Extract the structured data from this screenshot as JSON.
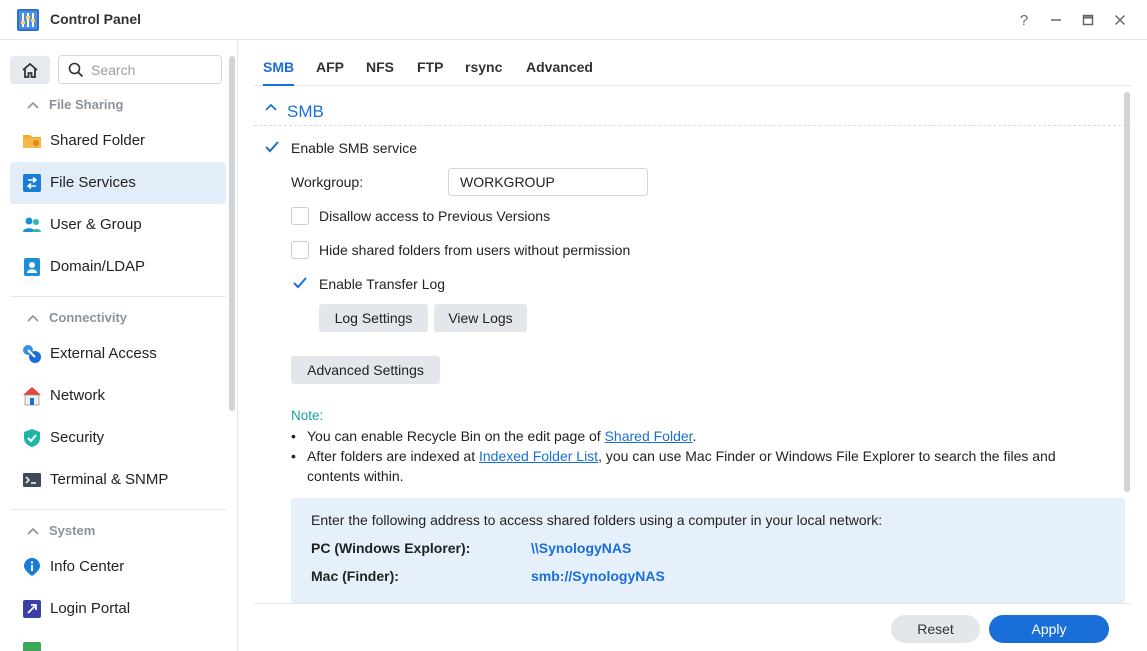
{
  "window": {
    "title": "Control Panel",
    "icon": "control-panel-icon",
    "controls": {
      "help": "?",
      "minimize": "—",
      "maximize": "▭",
      "close": "✕"
    }
  },
  "sidebar": {
    "search_placeholder": "Search",
    "sections": [
      {
        "label": "File Sharing",
        "items": [
          {
            "label": "Shared Folder",
            "icon": "folder-icon"
          },
          {
            "label": "File Services",
            "icon": "file-services-icon",
            "active": true
          },
          {
            "label": "User & Group",
            "icon": "users-icon"
          },
          {
            "label": "Domain/LDAP",
            "icon": "domain-icon"
          }
        ]
      },
      {
        "label": "Connectivity",
        "items": [
          {
            "label": "External Access",
            "icon": "external-access-icon"
          },
          {
            "label": "Network",
            "icon": "network-icon"
          },
          {
            "label": "Security",
            "icon": "shield-icon"
          },
          {
            "label": "Terminal & SNMP",
            "icon": "terminal-icon"
          }
        ]
      },
      {
        "label": "System",
        "items": [
          {
            "label": "Info Center",
            "icon": "info-icon"
          },
          {
            "label": "Login Portal",
            "icon": "login-portal-icon"
          }
        ]
      }
    ]
  },
  "tabs": [
    {
      "label": "SMB",
      "active": true
    },
    {
      "label": "AFP"
    },
    {
      "label": "NFS"
    },
    {
      "label": "FTP"
    },
    {
      "label": "rsync"
    },
    {
      "label": "Advanced"
    }
  ],
  "smb": {
    "section_title": "SMB",
    "enable_smb": {
      "label": "Enable SMB service",
      "checked": true
    },
    "workgroup": {
      "label": "Workgroup:",
      "value": "WORKGROUP"
    },
    "disallow_previous_versions": {
      "label": "Disallow access to Previous Versions",
      "checked": false
    },
    "hide_shared_folders": {
      "label": "Hide shared folders from users without permission",
      "checked": false
    },
    "enable_transfer_log": {
      "label": "Enable Transfer Log",
      "checked": true
    },
    "log_settings_button": "Log Settings",
    "view_logs_button": "View Logs",
    "advanced_settings_button": "Advanced Settings",
    "note": {
      "title": "Note:",
      "bullet1_prefix": "You can enable Recycle Bin on the edit page of ",
      "bullet1_link": "Shared Folder",
      "bullet1_suffix": ".",
      "bullet2_prefix": "After folders are indexed at ",
      "bullet2_link": "Indexed Folder List",
      "bullet2_suffix": ", you can use Mac Finder or Windows File Explorer to search the files and contents within."
    },
    "access_info": {
      "intro": "Enter the following address to access shared folders using a computer in your local network:",
      "pc_label": "PC (Windows Explorer):",
      "pc_value": "\\\\SynologyNAS",
      "mac_label": "Mac (Finder):",
      "mac_value": "smb://SynologyNAS"
    }
  },
  "footer": {
    "reset": "Reset",
    "apply": "Apply"
  },
  "colors": {
    "accent": "#1a6ed8",
    "active_bg": "#e3edf9",
    "note": "#1aa39a",
    "info_bg": "#e6f0fa"
  }
}
